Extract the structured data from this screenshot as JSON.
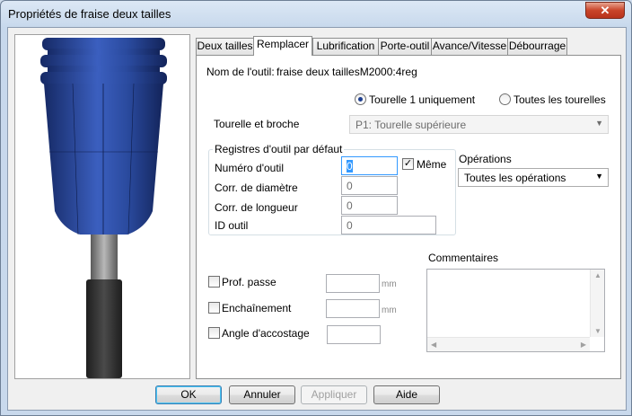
{
  "window": {
    "title": "Propriétés de fraise deux tailles",
    "close_glyph": "✕"
  },
  "tabs": [
    {
      "label": "Deux tailles"
    },
    {
      "label": "Remplacer"
    },
    {
      "label": "Lubrification"
    },
    {
      "label": "Porte-outil"
    },
    {
      "label": "Avance/Vitesse"
    },
    {
      "label": "Débourrage"
    }
  ],
  "active_tab": "Remplacer",
  "tool": {
    "name_label": "Nom de l'outil:",
    "name_value": "fraise deux taillesM2000:4reg"
  },
  "turret": {
    "option1": "Tourelle 1 uniquement",
    "option2": "Toutes les tourelles",
    "selected": "option1",
    "label": "Tourelle et broche",
    "value": "P1: Tourelle supérieure"
  },
  "registers": {
    "group_label": "Registres d'outil par défaut",
    "tool_number_label": "Numéro d'outil",
    "tool_number_value": "0",
    "same_label": "Même",
    "same_checked": true,
    "diameter_label": "Corr. de diamètre",
    "diameter_value": "0",
    "length_label": "Corr. de longueur",
    "length_value": "0",
    "id_label": "ID outil",
    "id_value": "0"
  },
  "operations": {
    "label": "Opérations",
    "value": "Toutes les opérations"
  },
  "options": {
    "depth_label": "Prof. passe",
    "depth_unit": "mm",
    "chain_label": "Enchaînement",
    "chain_unit": "mm",
    "approach_label": "Angle d'accostage"
  },
  "comments": {
    "label": "Commentaires",
    "value": ""
  },
  "buttons": {
    "ok": "OK",
    "cancel": "Annuler",
    "apply": "Appliquer",
    "help": "Aide"
  },
  "colors": {
    "tool_body": "#2a4a9e",
    "tool_shank": "#8a8a8a",
    "holder": "#3a3a3a",
    "accent": "#3399ff"
  }
}
